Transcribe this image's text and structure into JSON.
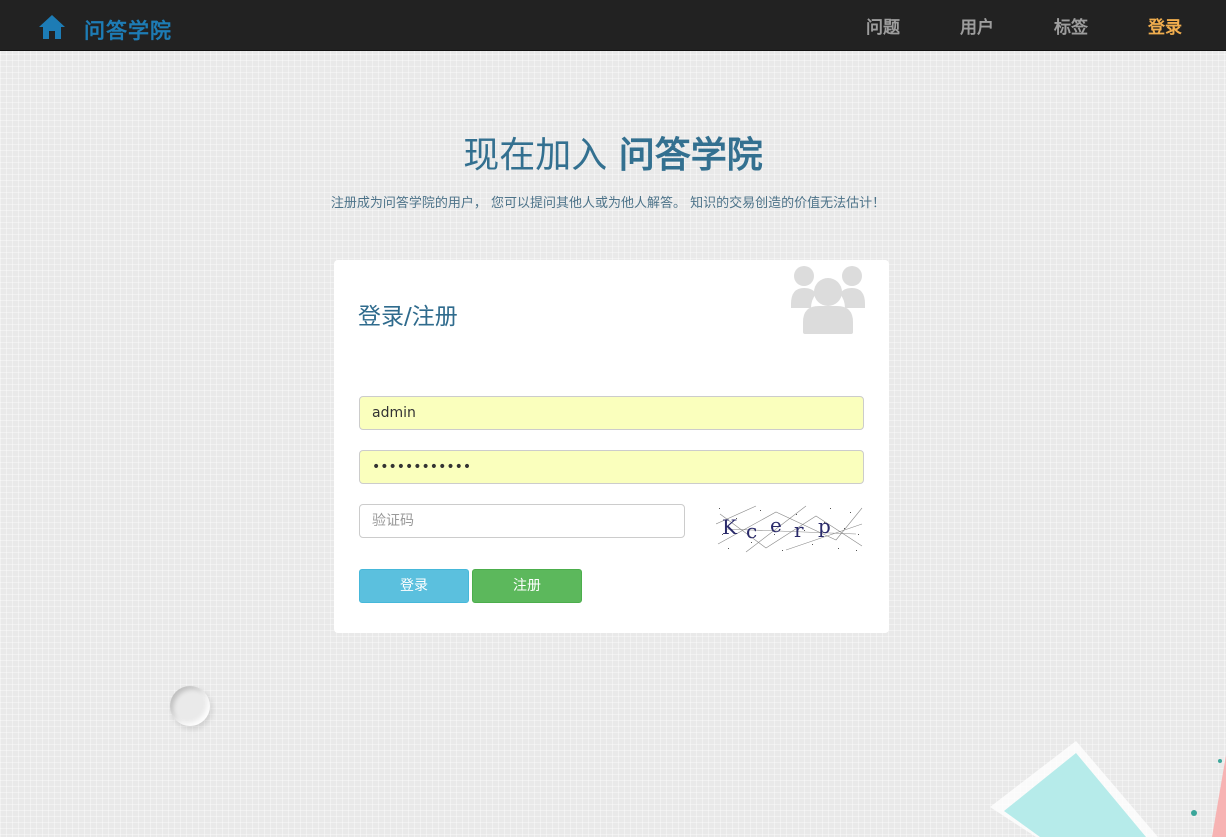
{
  "navbar": {
    "brand": "问答学院",
    "links": [
      "问题",
      "用户",
      "标签",
      "登录"
    ],
    "active_index": 3
  },
  "hero": {
    "title_plain": "现在加入 ",
    "title_strong": "问答学院",
    "subtitle": "注册成为问答学院的用户， 您可以提问其他人或为他人解答。 知识的交易创造的价值无法估计！"
  },
  "form": {
    "title": "登录/注册",
    "username_value": "admin",
    "password_value": "••••••••••••",
    "captcha_placeholder": "验证码",
    "captcha_chars": "Kcerp",
    "login_label": "登录",
    "register_label": "注册"
  },
  "colors": {
    "navbar_bg": "#222222",
    "brand": "#1d7cb5",
    "nav_active": "#f0ad4e",
    "title": "#337090",
    "login_btn": "#5bc0de",
    "register_btn": "#5cb85c",
    "autofill": "#faffbd"
  },
  "icons": {
    "home": "home-icon",
    "users": "users-icon"
  }
}
